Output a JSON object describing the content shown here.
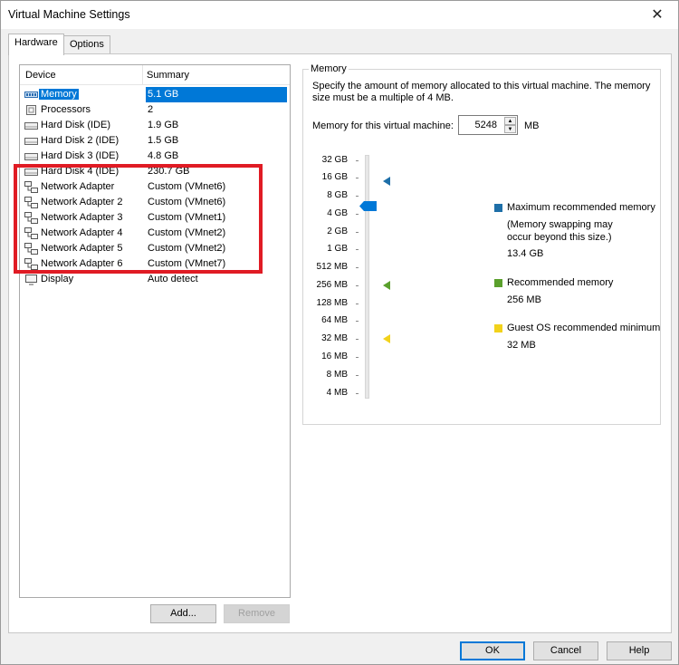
{
  "window": {
    "title": "Virtual Machine Settings",
    "close_glyph": "✕"
  },
  "tabs": [
    {
      "label": "Hardware"
    },
    {
      "label": "Options"
    }
  ],
  "device_list": {
    "col_device": "Device",
    "col_summary": "Summary",
    "rows": [
      {
        "device": "Memory",
        "summary": "5.1 GB",
        "icon": "memory-icon",
        "selected": true
      },
      {
        "device": "Processors",
        "summary": "2",
        "icon": "cpu-icon"
      },
      {
        "device": "Hard Disk (IDE)",
        "summary": "1.9 GB",
        "icon": "hard-disk-icon"
      },
      {
        "device": "Hard Disk 2 (IDE)",
        "summary": "1.5 GB",
        "icon": "hard-disk-icon"
      },
      {
        "device": "Hard Disk 3 (IDE)",
        "summary": "4.8 GB",
        "icon": "hard-disk-icon"
      },
      {
        "device": "Hard Disk 4 (IDE)",
        "summary": "230.7 GB",
        "icon": "hard-disk-icon"
      },
      {
        "device": "Network Adapter",
        "summary": "Custom (VMnet6)",
        "icon": "network-adapter-icon"
      },
      {
        "device": "Network Adapter 2",
        "summary": "Custom (VMnet6)",
        "icon": "network-adapter-icon"
      },
      {
        "device": "Network Adapter 3",
        "summary": "Custom (VMnet1)",
        "icon": "network-adapter-icon"
      },
      {
        "device": "Network Adapter 4",
        "summary": "Custom (VMnet2)",
        "icon": "network-adapter-icon"
      },
      {
        "device": "Network Adapter 5",
        "summary": "Custom (VMnet2)",
        "icon": "network-adapter-icon"
      },
      {
        "device": "Network Adapter 6",
        "summary": "Custom (VMnet7)",
        "icon": "network-adapter-icon"
      },
      {
        "device": "Display",
        "summary": "Auto detect",
        "icon": "display-icon"
      }
    ]
  },
  "buttons": {
    "add": "Add...",
    "remove": "Remove",
    "ok": "OK",
    "cancel": "Cancel",
    "help": "Help"
  },
  "memory": {
    "group_title": "Memory",
    "description": "Specify the amount of memory allocated to this virtual machine. The memory size must be a multiple of 4 MB.",
    "field_label": "Memory for this virtual machine:",
    "value": "5248",
    "unit": "MB",
    "scale": [
      "32 GB",
      "16 GB",
      "8 GB",
      "4 GB",
      "2 GB",
      "1 GB",
      "512 MB",
      "256 MB",
      "128 MB",
      "64 MB",
      "32 MB",
      "16 MB",
      "8 MB",
      "4 MB"
    ],
    "legend": {
      "max_title": "Maximum recommended memory",
      "max_note": "(Memory swapping may occur beyond this size.)",
      "max_value": "13.4 GB",
      "rec_title": "Recommended memory",
      "rec_value": "256 MB",
      "guest_title": "Guest OS recommended minimum",
      "guest_value": "32 MB"
    },
    "colors": {
      "max": "#1e6fa8",
      "recommended": "#5aa02c",
      "guest_min": "#f2d21b",
      "thumb": "#0078d7"
    }
  },
  "highlight": {
    "color": "#e01b24"
  }
}
